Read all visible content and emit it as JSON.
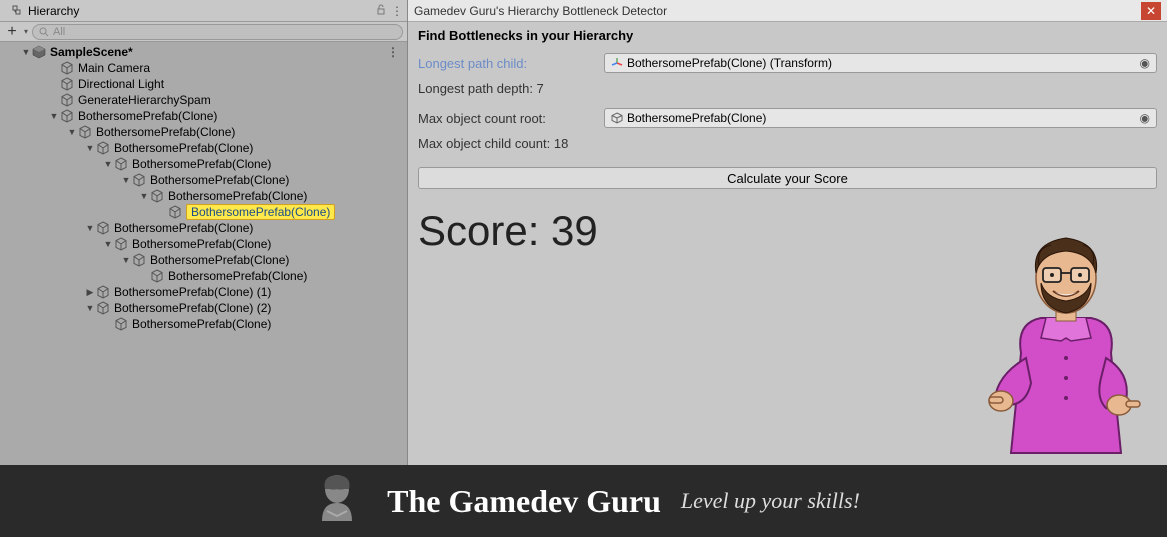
{
  "hierarchy": {
    "tab_label": "Hierarchy",
    "search_placeholder": "All",
    "scene_name": "SampleScene*",
    "items": [
      {
        "indent": 1,
        "arrow": "none",
        "label": "Main Camera",
        "highlighted": false
      },
      {
        "indent": 1,
        "arrow": "none",
        "label": "Directional Light",
        "highlighted": false
      },
      {
        "indent": 1,
        "arrow": "none",
        "label": "GenerateHierarchySpam",
        "highlighted": false
      },
      {
        "indent": 1,
        "arrow": "down",
        "label": "BothersomePrefab(Clone)",
        "highlighted": false
      },
      {
        "indent": 2,
        "arrow": "down",
        "label": "BothersomePrefab(Clone)",
        "highlighted": false
      },
      {
        "indent": 3,
        "arrow": "down",
        "label": "BothersomePrefab(Clone)",
        "highlighted": false
      },
      {
        "indent": 4,
        "arrow": "down",
        "label": "BothersomePrefab(Clone)",
        "highlighted": false
      },
      {
        "indent": 5,
        "arrow": "down",
        "label": "BothersomePrefab(Clone)",
        "highlighted": false
      },
      {
        "indent": 6,
        "arrow": "down",
        "label": "BothersomePrefab(Clone)",
        "highlighted": false
      },
      {
        "indent": 7,
        "arrow": "none",
        "label": "BothersomePrefab(Clone)",
        "highlighted": true
      },
      {
        "indent": 3,
        "arrow": "down",
        "label": "BothersomePrefab(Clone)",
        "highlighted": false
      },
      {
        "indent": 4,
        "arrow": "down",
        "label": "BothersomePrefab(Clone)",
        "highlighted": false
      },
      {
        "indent": 5,
        "arrow": "down",
        "label": "BothersomePrefab(Clone)",
        "highlighted": false
      },
      {
        "indent": 6,
        "arrow": "none",
        "label": "BothersomePrefab(Clone)",
        "highlighted": false
      },
      {
        "indent": 3,
        "arrow": "right",
        "label": "BothersomePrefab(Clone) (1)",
        "highlighted": false
      },
      {
        "indent": 3,
        "arrow": "down",
        "label": "BothersomePrefab(Clone) (2)",
        "highlighted": false
      },
      {
        "indent": 4,
        "arrow": "none",
        "label": "BothersomePrefab(Clone)",
        "highlighted": false
      }
    ]
  },
  "detector": {
    "window_title": "Gamedev Guru's Hierarchy Bottleneck Detector",
    "heading": "Find Bottlenecks in your Hierarchy",
    "longest_path_child_label": "Longest path child:",
    "longest_path_child_value": "BothersomePrefab(Clone) (Transform)",
    "longest_path_depth_label": "Longest path depth: 7",
    "max_object_root_label": "Max object count root:",
    "max_object_root_value": "BothersomePrefab(Clone)",
    "max_object_child_count_label": "Max object child count: 18",
    "calculate_button": "Calculate your Score",
    "score_text": "Score: 39"
  },
  "footer": {
    "brand": "The Gamedev Guru",
    "tagline": "Level up your skills!"
  }
}
